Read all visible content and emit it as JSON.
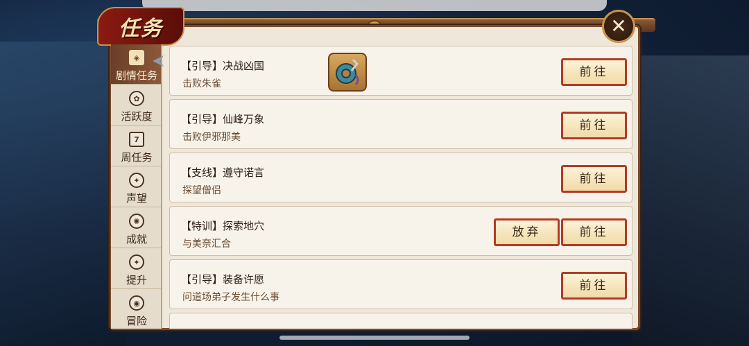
{
  "window": {
    "title": "任务",
    "close_icon": "close-x-icon"
  },
  "sidebar": {
    "items": [
      {
        "label": "剧情任务",
        "icon": "scroll-icon",
        "glyph": "◈",
        "active": true
      },
      {
        "label": "活跃度",
        "icon": "clover-icon",
        "glyph": "✿",
        "active": false
      },
      {
        "label": "周任务",
        "icon": "calendar-icon",
        "glyph": "7",
        "active": false
      },
      {
        "label": "声望",
        "icon": "emblem-icon",
        "glyph": "✦",
        "active": false
      },
      {
        "label": "成就",
        "icon": "medal-icon",
        "glyph": "✺",
        "active": false
      },
      {
        "label": "提升",
        "icon": "upgrade-icon",
        "glyph": "✦",
        "active": false
      },
      {
        "label": "冒险",
        "icon": "adventure-icon",
        "glyph": "◉",
        "active": false
      }
    ]
  },
  "tasks": [
    {
      "title": "【引导】决战凶国",
      "desc": "击败朱雀",
      "reward": "jade-ring-icon",
      "go": "前往"
    },
    {
      "title": "【引导】仙峰万象",
      "desc": "击败伊邪那美",
      "go": "前往"
    },
    {
      "title": "【支线】遵守诺言",
      "desc": "探望僧侣",
      "go": "前往"
    },
    {
      "title": "【特训】探索地穴",
      "desc": "与美奈汇合",
      "abandon": "放弃",
      "go": "前往"
    },
    {
      "title": "【引导】装备许愿",
      "desc": "问道场弟子发生什么事",
      "go": "前往"
    }
  ],
  "colors": {
    "button_border": "#b33a25",
    "panel_bg": "#efe7d9",
    "active_tab": "#6a3e28"
  }
}
